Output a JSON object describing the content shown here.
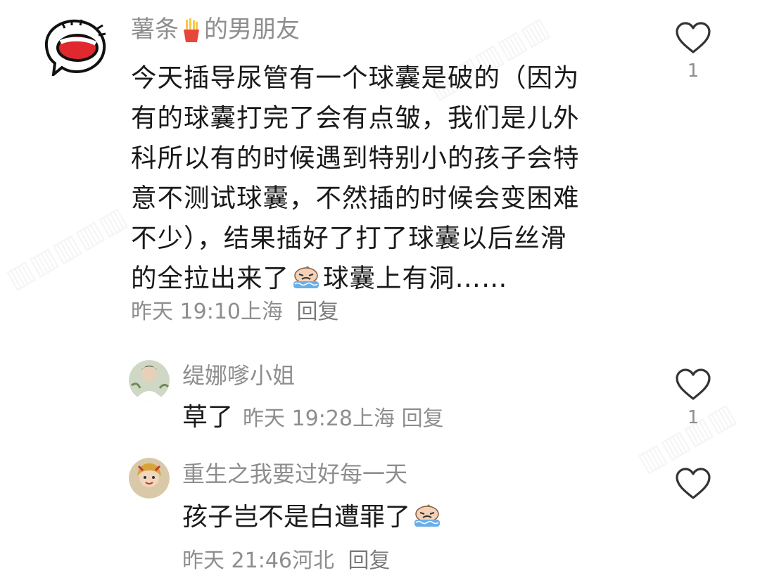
{
  "main_comment": {
    "username_part1": "薯条",
    "username_part2": "的男朋友",
    "body_lines": [
      "今天插导尿管有一个球囊是破的（因为",
      "有的球囊打完了会有点皱，我们是儿外",
      "科所以有的时候遇到特别小的孩子会特",
      "意不测试球囊，不然插的时候会变困难",
      "不少），结果插好了打了球囊以后丝滑",
      "的全拉出来了",
      "球囊上有洞……"
    ],
    "time": "昨天 19:10",
    "location": "上海",
    "reply_label": "回复",
    "like_count": "1"
  },
  "replies": [
    {
      "username": "缇娜嗲小姐",
      "text": "草了",
      "time": "昨天 19:28",
      "location": "上海",
      "reply_label": "回复",
      "like_count": "1"
    },
    {
      "username": "重生之我要过好每一天",
      "text": "孩子岂不是白遭罪了",
      "time": "昨天 21:46",
      "location": "河北",
      "reply_label": "回复",
      "like_count": ""
    }
  ],
  "icons": {
    "like": "heart-outline-icon",
    "fries": "fries-emoji-icon",
    "crying": "crying-emoji-icon"
  },
  "colors": {
    "text_primary": "#1a1a1a",
    "text_secondary": "#8e8e8e",
    "avatar_red": "#e0282e"
  }
}
